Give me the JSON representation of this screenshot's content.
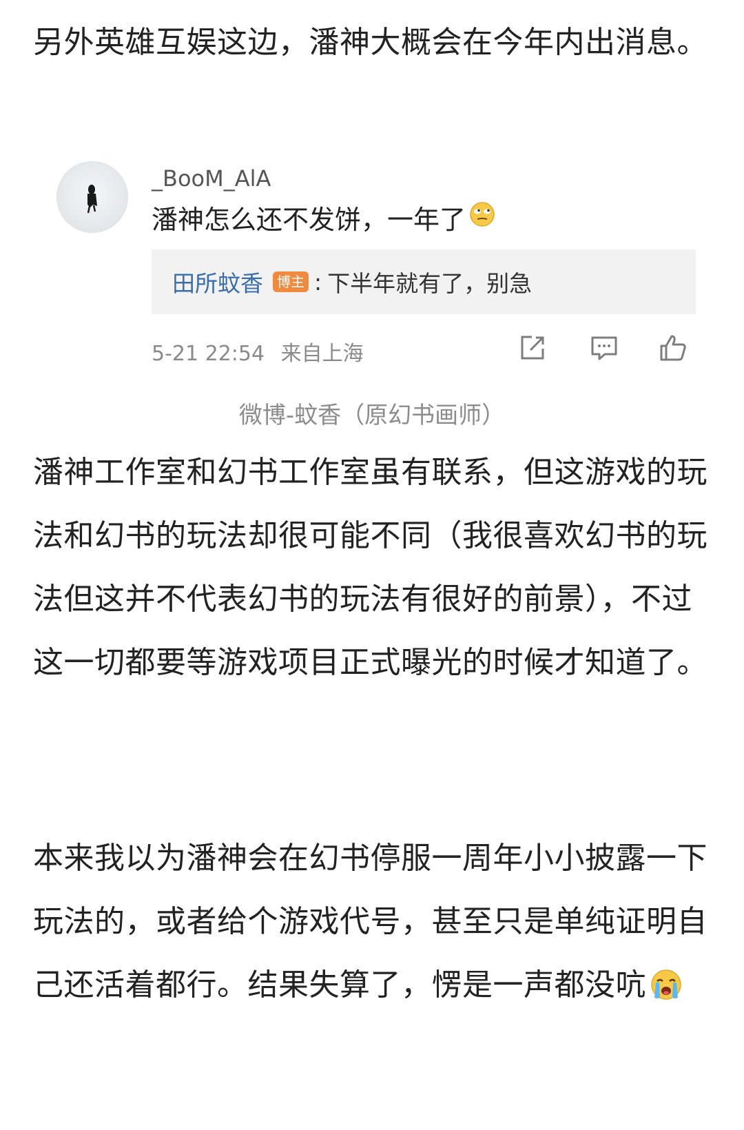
{
  "paragraph1": "另外英雄互娱这边，潘神大概会在今年内出消息。",
  "comment": {
    "username": "_BooM_AlA",
    "text": "潘神怎么还不发饼，一年了",
    "emoji": "rolling-eyes-emoji",
    "reply": {
      "author": "田所蚊香",
      "badge": "博主",
      "separator": ":",
      "text": "下半年就有了，别急"
    },
    "meta": {
      "time": "5-21 22:54",
      "location": "来自上海"
    },
    "icons": [
      "share-icon",
      "comment-icon",
      "like-icon"
    ]
  },
  "caption": "微博-蚊香（原幻书画师）",
  "paragraph2": "潘神工作室和幻书工作室虽有联系，但这游戏的玩法和幻书的玩法却很可能不同（我很喜欢幻书的玩法但这并不代表幻书的玩法有很好的前景），不过这一切都要等游戏项目正式曝光的时候才知道了。",
  "paragraph3": "本来我以为潘神会在幻书停服一周年小小披露一下玩法的，或者给个游戏代号，甚至只是单纯证明自己还活着都行。结果失算了，愣是一声都没吭",
  "paragraph3_emoji": "crying-emoji",
  "colors": {
    "text": "#222222",
    "link": "#3b6ea8",
    "badge": "#f08a3e",
    "muted": "#8a8a8a",
    "reply_bg": "#f2f2f2"
  }
}
